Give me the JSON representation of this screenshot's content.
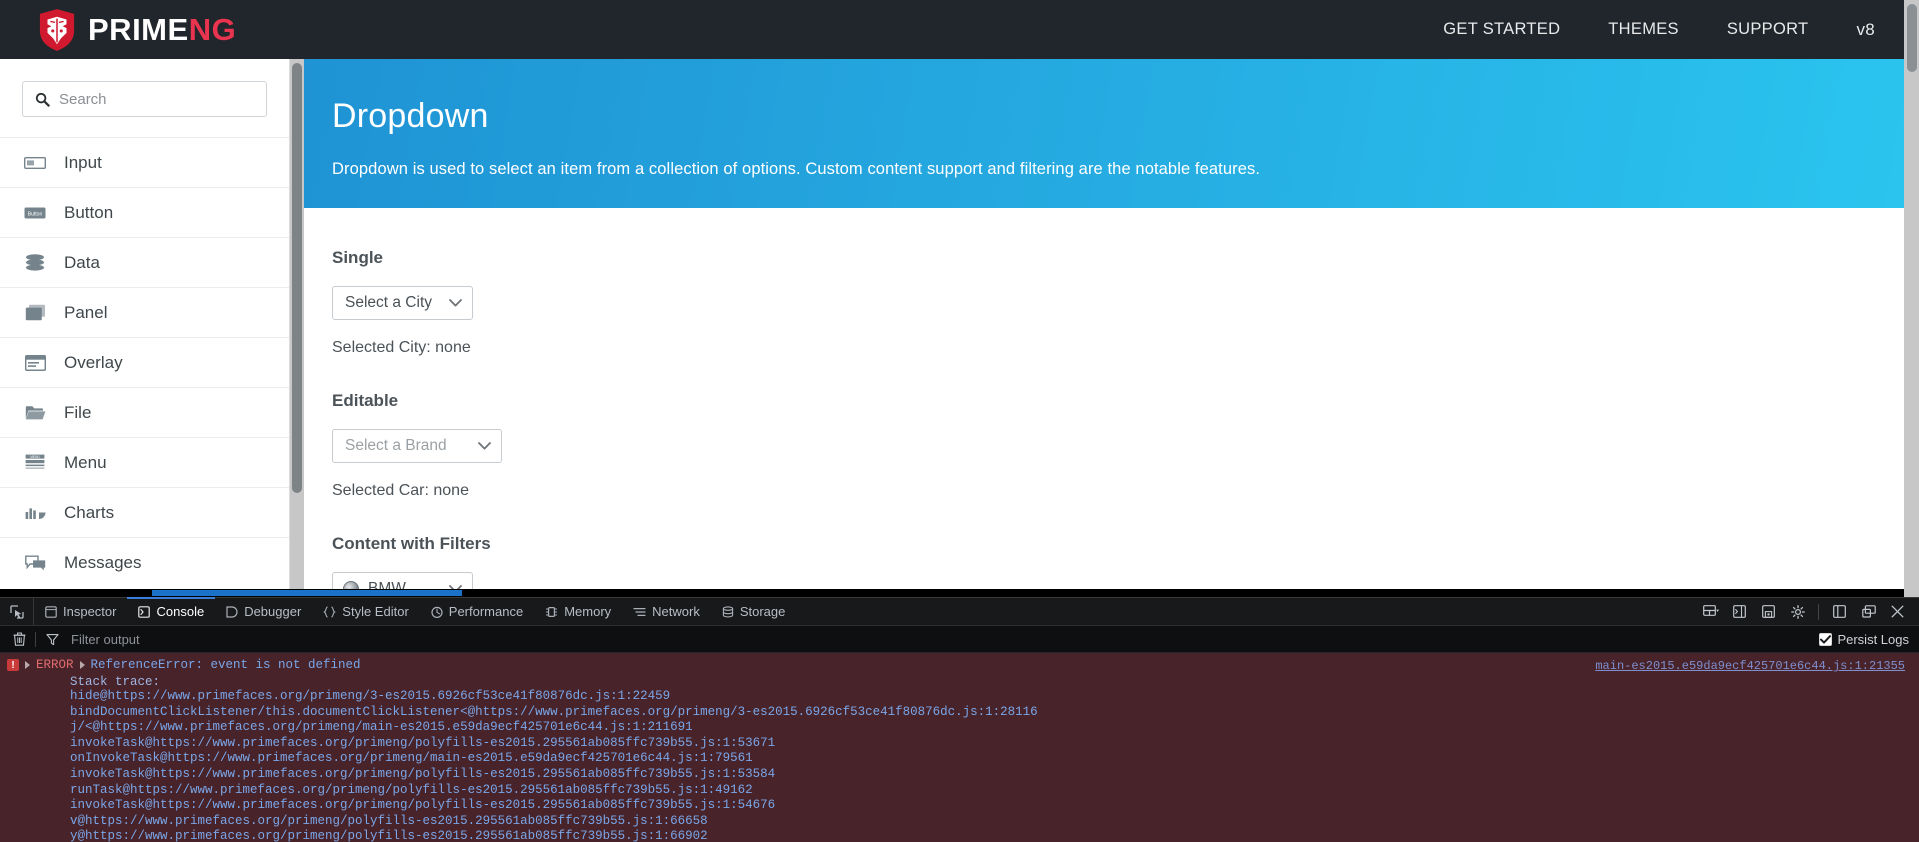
{
  "topbar": {
    "logo_text_light": "PRIME",
    "logo_text_accent": "NG",
    "logo_icon": "primeng-shield-logo",
    "nav": [
      {
        "label": "GET STARTED",
        "name": "nav-get-started"
      },
      {
        "label": "THEMES",
        "name": "nav-themes"
      },
      {
        "label": "SUPPORT",
        "name": "nav-support"
      },
      {
        "label": "v8",
        "name": "nav-version"
      }
    ],
    "background": "#20262b",
    "accent": "#e8344e"
  },
  "sidebar": {
    "search": {
      "placeholder": "Search",
      "value": "",
      "icon": "search-icon"
    },
    "items": [
      {
        "label": "Input",
        "icon": "input-field-icon"
      },
      {
        "label": "Button",
        "icon": "button-icon"
      },
      {
        "label": "Data",
        "icon": "database-stack-icon"
      },
      {
        "label": "Panel",
        "icon": "panel-icon"
      },
      {
        "label": "Overlay",
        "icon": "overlay-window-icon"
      },
      {
        "label": "File",
        "icon": "folder-icon"
      },
      {
        "label": "Menu",
        "icon": "menu-icon"
      },
      {
        "label": "Charts",
        "icon": "bar-chart-icon"
      },
      {
        "label": "Messages",
        "icon": "speech-bubble-icon"
      }
    ]
  },
  "main": {
    "header": {
      "title": "Dropdown",
      "description": "Dropdown is used to select an item from a collection of options. Custom content support and filtering are the notable features.",
      "gradient_from": "#1f93d4",
      "gradient_to": "#2ac4ef"
    },
    "sections": [
      {
        "title": "Single",
        "dropdown": {
          "value": "Select a City",
          "muted": true,
          "name": "city-dropdown"
        },
        "status": "Selected City: none"
      },
      {
        "title": "Editable",
        "dropdown": {
          "value": "Select a Brand",
          "muted": true,
          "name": "brand-dropdown"
        },
        "status": "Selected Car: none"
      },
      {
        "title": "Content with Filters",
        "dropdown": {
          "value": "BMW",
          "muted": false,
          "name": "filter-dropdown",
          "has_logo": true
        },
        "status": ""
      }
    ],
    "caret_icon": "chevron-down-icon"
  },
  "devtools": {
    "picker_icon": "element-picker-icon",
    "tabs": [
      {
        "label": "Inspector",
        "icon": "inspector-icon",
        "active": false
      },
      {
        "label": "Console",
        "icon": "console-icon",
        "active": true
      },
      {
        "label": "Debugger",
        "icon": "debugger-icon",
        "active": false
      },
      {
        "label": "Style Editor",
        "icon": "braces-icon",
        "active": false
      },
      {
        "label": "Performance",
        "icon": "stopwatch-icon",
        "active": false
      },
      {
        "label": "Memory",
        "icon": "memory-icon",
        "active": false
      },
      {
        "label": "Network",
        "icon": "network-icon",
        "active": false
      },
      {
        "label": "Storage",
        "icon": "storage-icon",
        "active": false
      }
    ],
    "right_buttons": [
      {
        "name": "responsive-design-mode-button",
        "icon": "layout-split-icon"
      },
      {
        "name": "split-console-button",
        "icon": "split-console-icon"
      },
      {
        "name": "screenshot-button",
        "icon": "camera-icon"
      },
      {
        "name": "settings-button",
        "icon": "gear-icon"
      },
      {
        "name": "dock-side-button",
        "icon": "dock-side-icon"
      },
      {
        "name": "dock-separate-button",
        "icon": "dock-window-icon"
      },
      {
        "name": "close-devtools-button",
        "icon": "close-icon"
      }
    ],
    "filterbar": {
      "clear_icon": "trash-icon",
      "filter_icon": "funnel-icon",
      "placeholder": "Filter output",
      "value": "",
      "persist_label": "Persist Logs",
      "persist_checked": true
    },
    "console": {
      "level_badge": "!",
      "level_label": "ERROR",
      "message": "ReferenceError: event is not defined",
      "source_link": "main-es2015.e59da9ecf425701e6c44.js:1:21355",
      "stack_label": "Stack trace:",
      "stack": [
        "hide@https://www.primefaces.org/primeng/3-es2015.6926cf53ce41f80876dc.js:1:22459",
        "bindDocumentClickListener/this.documentClickListener<@https://www.primefaces.org/primeng/3-es2015.6926cf53ce41f80876dc.js:1:28116",
        "j/<@https://www.primefaces.org/primeng/main-es2015.e59da9ecf425701e6c44.js:1:211691",
        "invokeTask@https://www.primefaces.org/primeng/polyfills-es2015.295561ab085ffc739b55.js:1:53671",
        "onInvokeTask@https://www.primefaces.org/primeng/main-es2015.e59da9ecf425701e6c44.js:1:79561",
        "invokeTask@https://www.primefaces.org/primeng/polyfills-es2015.295561ab085ffc739b55.js:1:53584",
        "runTask@https://www.primefaces.org/primeng/polyfills-es2015.295561ab085ffc739b55.js:1:49162",
        "invokeTask@https://www.primefaces.org/primeng/polyfills-es2015.295561ab085ffc739b55.js:1:54676",
        "v@https://www.primefaces.org/primeng/polyfills-es2015.295561ab085ffc739b55.js:1:66658",
        "y@https://www.primefaces.org/primeng/polyfills-es2015.295561ab085ffc739b55.js:1:66902"
      ]
    }
  }
}
